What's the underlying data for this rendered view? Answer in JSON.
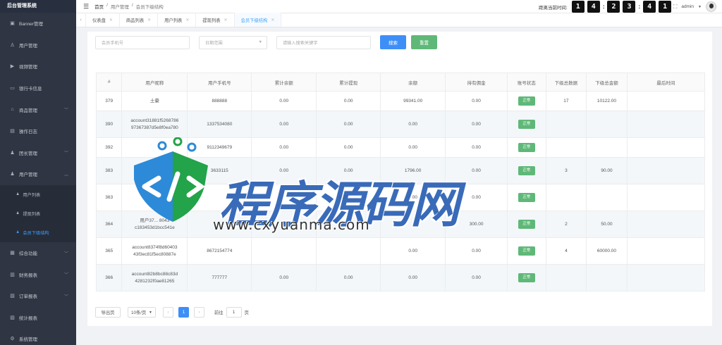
{
  "sidebar": {
    "title": "后台管理系统",
    "items": [
      {
        "label": "Banner管理",
        "icon": "picture-icon",
        "chevron": false
      },
      {
        "label": "用户管理",
        "icon": "user-icon",
        "chevron": false
      },
      {
        "label": "视频管理",
        "icon": "video-icon",
        "chevron": false
      },
      {
        "label": "银行卡信息",
        "icon": "card-icon",
        "chevron": false
      },
      {
        "label": "商品管理",
        "icon": "shop-icon",
        "chevron": true
      },
      {
        "label": "操作日志",
        "icon": "doc-icon",
        "chevron": false
      },
      {
        "label": "团长管理",
        "icon": "person-icon",
        "chevron": true
      },
      {
        "label": "用户管理",
        "icon": "person-icon",
        "chevron": true,
        "expanded": true
      }
    ],
    "sub_items": [
      {
        "label": "用户列表",
        "active": false
      },
      {
        "label": "提现列表",
        "active": false
      },
      {
        "label": "会员下级结构",
        "active": true
      }
    ],
    "items_after": [
      {
        "label": "综合功能",
        "icon": "grid-icon",
        "chevron": true
      },
      {
        "label": "财务报表",
        "icon": "chart-icon",
        "chevron": true
      },
      {
        "label": "订单报表",
        "icon": "order-icon",
        "chevron": true
      },
      {
        "label": "统计报表",
        "icon": "stats-icon",
        "chevron": false
      },
      {
        "label": "系统管理",
        "icon": "gear-icon",
        "chevron": false
      }
    ]
  },
  "header": {
    "breadcrumb": [
      "首页",
      "用户管理",
      "会员下级结构"
    ],
    "countdown_label": "距离当前时间:",
    "digits": [
      "1",
      "4",
      "2",
      "3",
      "4",
      "1"
    ],
    "user": "admin"
  },
  "tabs": [
    {
      "label": "仪表盘",
      "active": false
    },
    {
      "label": "商品列表",
      "active": false
    },
    {
      "label": "用户列表",
      "active": false
    },
    {
      "label": "提现列表",
      "active": false
    },
    {
      "label": "会员下级结构",
      "active": true
    }
  ],
  "filters": {
    "search_placeholder": "会员手机号",
    "select_value": "日期范围",
    "keyword_placeholder": "请输入搜索关键字",
    "search_button": "搜索",
    "reset_button": "重置"
  },
  "table": {
    "columns": [
      "#",
      "用户昵称",
      "用户手机号",
      "累计余额",
      "累计提现",
      "余额",
      "持有佣金",
      "账号状态",
      "下级总数据",
      "下级总金额",
      "最后时间"
    ],
    "rows": [
      {
        "id": "379",
        "nick": "土豪",
        "phone": "888888",
        "c1": "0.00",
        "c2": "0.00",
        "c3": "99341.00",
        "c4": "0.00",
        "status": "正常",
        "sub": "17",
        "amt": "10122.00",
        "last": ""
      },
      {
        "id": "390",
        "nick": "account31881f5268786 97367387d5e8f0ea780",
        "phone": "1337534080",
        "c1": "0.00",
        "c2": "0.00",
        "c3": "0.00",
        "c4": "0.00",
        "status": "正常",
        "sub": "",
        "amt": "",
        "last": ""
      },
      {
        "id": "392",
        "nick": "",
        "phone": "9112349679",
        "c1": "0.00",
        "c2": "0.00",
        "c3": "0.00",
        "c4": "0.00",
        "status": "正常",
        "sub": "",
        "amt": "",
        "last": ""
      },
      {
        "id": "383",
        "nick": "",
        "phone": "3633115",
        "c1": "0.00",
        "c2": "0.00",
        "c3": "1796.00",
        "c4": "0.00",
        "status": "正常",
        "sub": "3",
        "amt": "90.00",
        "last": ""
      },
      {
        "id": "363",
        "nick": "",
        "phone": "",
        "c1": "",
        "c2": "10733.00",
        "c3": "0.00",
        "c4": "0.00",
        "status": "正常",
        "sub": "",
        "amt": "",
        "last": ""
      },
      {
        "id": "364",
        "nick": "用户37... 8043 c183453d1bcc541e",
        "phone": "",
        "c1": "",
        "c2": "",
        "c3": "",
        "c4": "300.00",
        "status": "正常",
        "sub": "2",
        "amt": "50.00",
        "last": ""
      },
      {
        "id": "365",
        "nick": "account8374f8d60403 43f3ec81f5ec80887e",
        "phone": "8672154774",
        "c1": "",
        "c2": "",
        "c3": "0.00",
        "c4": "0.00",
        "status": "正常",
        "sub": "4",
        "amt": "60000.00",
        "last": ""
      },
      {
        "id": "366",
        "nick": "account82b8bc88c83d 4281232f0ae81265",
        "phone": "777777",
        "c1": "0.00",
        "c2": "0.00",
        "c3": "0.00",
        "c4": "0.00",
        "status": "正常",
        "sub": "",
        "amt": "",
        "last": ""
      }
    ]
  },
  "pagination": {
    "export_label": "导出页",
    "per_page": "10条/页",
    "prev": "‹",
    "current": "1",
    "next": "›",
    "goto_label": "前往",
    "goto_value": "1",
    "page_label": "页"
  },
  "watermark": {
    "text": "程序源码网",
    "url": "www.cxyuanma.com"
  },
  "colors": {
    "sidebar_bg": "#2f3542",
    "accent": "#3ea0ff",
    "success": "#5fb878",
    "reset_green": "#5fb878"
  }
}
